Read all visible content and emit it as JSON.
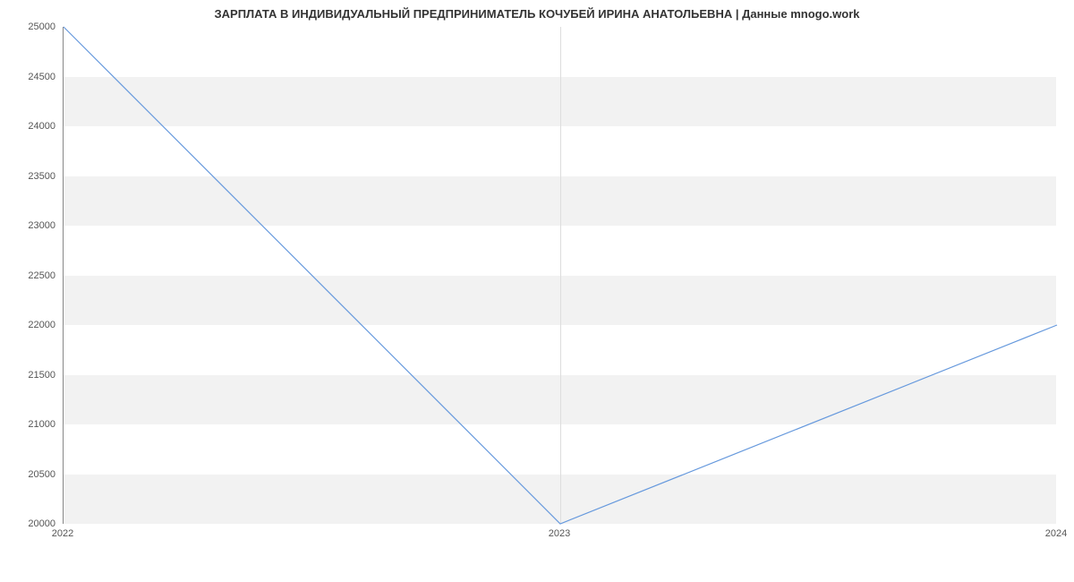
{
  "chart_data": {
    "type": "line",
    "title": "ЗАРПЛАТА В ИНДИВИДУАЛЬНЫЙ ПРЕДПРИНИМАТЕЛЬ КОЧУБЕЙ ИРИНА АНАТОЛЬЕВНА | Данные mnogo.work",
    "x": [
      2022,
      2023,
      2024
    ],
    "values": [
      25000,
      20000,
      22000
    ],
    "xlabel": "",
    "ylabel": "",
    "xlim": [
      2022,
      2024
    ],
    "ylim": [
      20000,
      25000
    ],
    "x_ticks": [
      2022,
      2023,
      2024
    ],
    "y_ticks": [
      20000,
      20500,
      21000,
      21500,
      22000,
      22500,
      23000,
      23500,
      24000,
      24500,
      25000
    ],
    "line_color": "#6699dd"
  }
}
